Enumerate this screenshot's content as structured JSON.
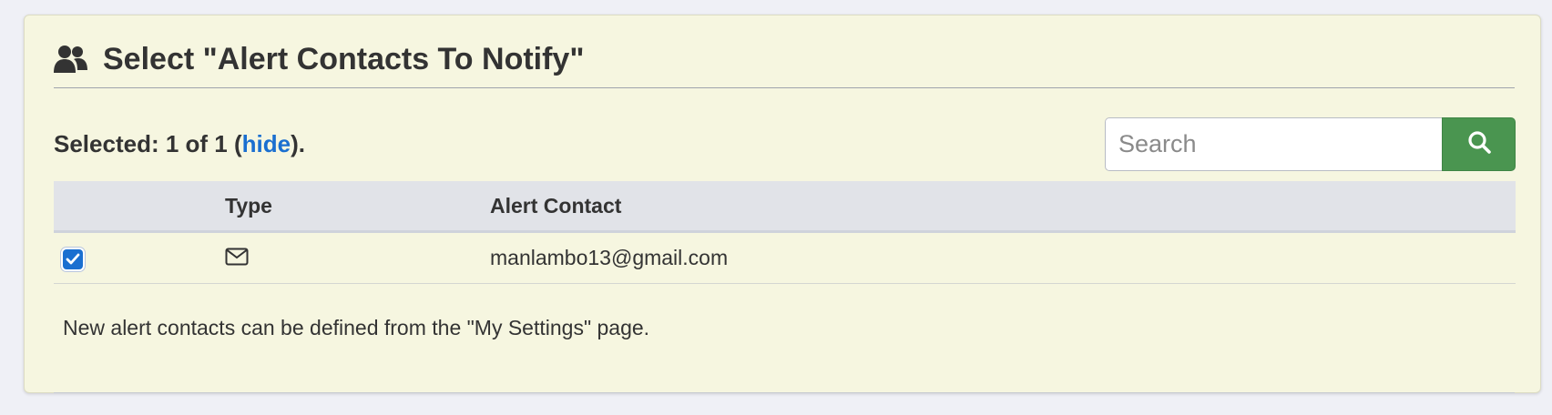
{
  "header": {
    "title": "Select \"Alert Contacts To Notify\"",
    "icon": "users-icon"
  },
  "selection": {
    "prefix": "Selected: 1 of 1 (",
    "toggle_link": "hide",
    "suffix": ")."
  },
  "search": {
    "placeholder": "Search",
    "value": "",
    "button_icon": "search-icon"
  },
  "table": {
    "columns": [
      "",
      "Type",
      "Alert Contact"
    ],
    "rows": [
      {
        "checked": true,
        "type_icon": "envelope-icon",
        "contact": "manlambo13@gmail.com"
      }
    ],
    "note": "New alert contacts can be defined from the \"My Settings\" page."
  },
  "colors": {
    "panel_bg": "#f6f6e0",
    "link": "#1a6fd0",
    "search_button": "#4a9550",
    "table_header_bg": "#e1e3e8",
    "checkbox": "#1a6fd0"
  }
}
